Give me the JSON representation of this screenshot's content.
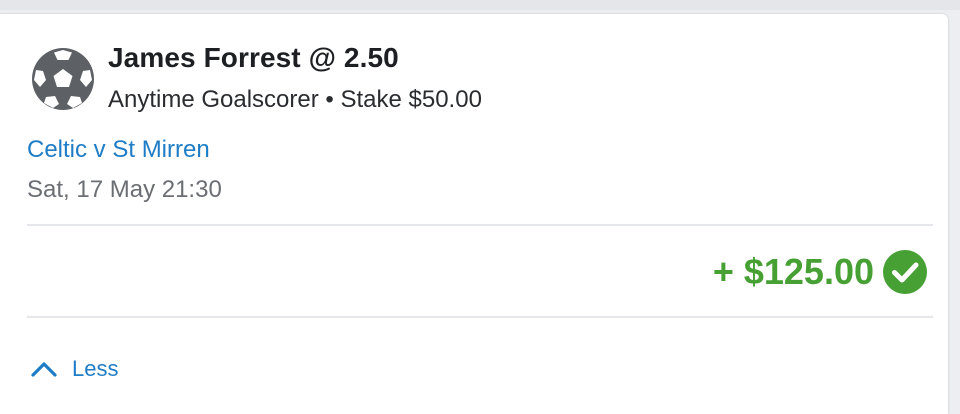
{
  "bet": {
    "title": "James Forrest @ 2.50",
    "subtitle": "Anytime Goalscorer • Stake $50.00",
    "sport_icon": "soccer-ball-icon"
  },
  "event": {
    "name": "Celtic v St Mirren",
    "datetime": "Sat, 17 May 21:30"
  },
  "result": {
    "payout": "+ $125.00",
    "status_icon": "check-circle-icon",
    "status_color": "#46a034"
  },
  "toggle": {
    "label": "Less",
    "icon": "chevron-up-icon"
  },
  "colors": {
    "link": "#1e7dc6",
    "win": "#46a034"
  }
}
